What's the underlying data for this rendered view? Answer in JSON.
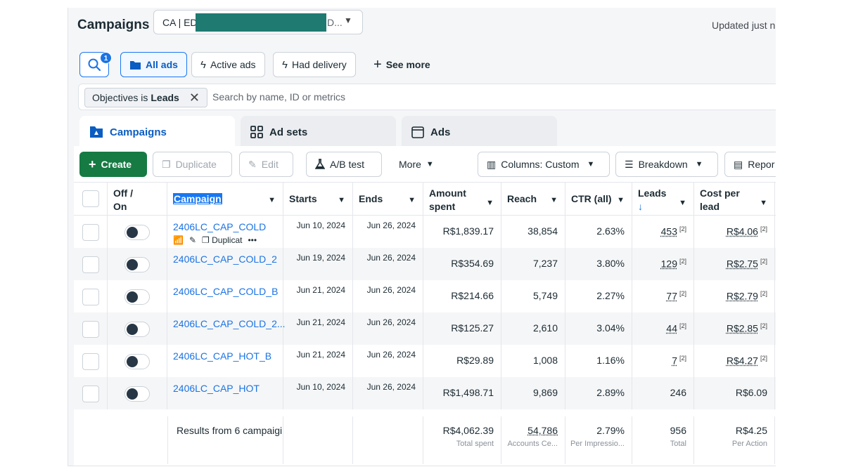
{
  "header": {
    "title": "Campaigns",
    "account_label": "CA | ED",
    "account_suffix": "D...",
    "updated": "Updated just n"
  },
  "filters": {
    "search_badge": "1",
    "all_ads": "All ads",
    "active_ads": "Active ads",
    "had_delivery": "Had delivery",
    "see_more": "See more",
    "chip_prefix": "Objectives is ",
    "chip_value": "Leads",
    "search_placeholder": "Search by name, ID or metrics"
  },
  "tabs": {
    "campaigns": "Campaigns",
    "ad_sets": "Ad sets",
    "ads": "Ads"
  },
  "toolbar": {
    "create": "Create",
    "duplicate": "Duplicate",
    "edit": "Edit",
    "ab_test": "A/B test",
    "more": "More",
    "columns": "Columns: Custom",
    "breakdown": "Breakdown",
    "reports": "Repor"
  },
  "columns": {
    "off_on_1": "Off /",
    "off_on_2": "On",
    "campaign": "Campaign",
    "starts": "Starts",
    "ends": "Ends",
    "amount_1": "Amount",
    "amount_2": "spent",
    "reach": "Reach",
    "ctr": "CTR (all)",
    "leads": "Leads",
    "cpl_1": "Cost per",
    "cpl_2": "lead"
  },
  "row_actions": {
    "duplicate": "Duplicat",
    "more": "•••"
  },
  "rows": [
    {
      "name": "2406LC_CAP_COLD",
      "starts": "Jun 10, 2024",
      "ends": "Jun 26, 2024",
      "amount": "R$1,839.17",
      "reach": "38,854",
      "ctr": "2.63%",
      "leads": "453",
      "leads_sup": "[2]",
      "cpl": "R$4.06",
      "cpl_sup": "[2]"
    },
    {
      "name": "2406LC_CAP_COLD_2",
      "starts": "Jun 19, 2024",
      "ends": "Jun 26, 2024",
      "amount": "R$354.69",
      "reach": "7,237",
      "ctr": "3.80%",
      "leads": "129",
      "leads_sup": "[2]",
      "cpl": "R$2.75",
      "cpl_sup": "[2]"
    },
    {
      "name": "2406LC_CAP_COLD_B",
      "starts": "Jun 21, 2024",
      "ends": "Jun 26, 2024",
      "amount": "R$214.66",
      "reach": "5,749",
      "ctr": "2.27%",
      "leads": "77",
      "leads_sup": "[2]",
      "cpl": "R$2.79",
      "cpl_sup": "[2]"
    },
    {
      "name": "2406LC_CAP_COLD_2...",
      "starts": "Jun 21, 2024",
      "ends": "Jun 26, 2024",
      "amount": "R$125.27",
      "reach": "2,610",
      "ctr": "3.04%",
      "leads": "44",
      "leads_sup": "[2]",
      "cpl": "R$2.85",
      "cpl_sup": "[2]"
    },
    {
      "name": "2406LC_CAP_HOT_B",
      "starts": "Jun 21, 2024",
      "ends": "Jun 26, 2024",
      "amount": "R$29.89",
      "reach": "1,008",
      "ctr": "1.16%",
      "leads": "7",
      "leads_sup": "[2]",
      "cpl": "R$4.27",
      "cpl_sup": "[2]"
    },
    {
      "name": "2406LC_CAP_HOT",
      "starts": "Jun 10, 2024",
      "ends": "Jun 26, 2024",
      "amount": "R$1,498.71",
      "reach": "9,869",
      "ctr": "2.89%",
      "leads": "246",
      "leads_sup": "",
      "cpl": "R$6.09",
      "cpl_sup": ""
    }
  ],
  "totals": {
    "label": "Results from 6 campaigi",
    "amount": "R$4,062.39",
    "amount_sub": "Total spent",
    "reach": "54,786",
    "reach_sub": "Accounts Ce...",
    "ctr": "2.79%",
    "ctr_sub": "Per Impressio...",
    "leads": "956",
    "leads_sub": "Total",
    "cpl": "R$4.25",
    "cpl_sub": "Per Action"
  },
  "colors": {
    "accent": "#1877f2",
    "create_green": "#167a43",
    "redaction": "#1f7a72"
  }
}
